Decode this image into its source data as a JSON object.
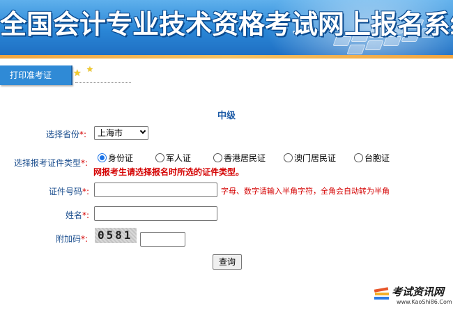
{
  "banner": {
    "title": "全国会计专业技术资格考试网上报名系统",
    "colors": {
      "top": "#5fb0ec",
      "bottom": "#1f6fc3",
      "stripe": "#f2a540"
    }
  },
  "nav": {
    "active_tab": "打印准考证",
    "star_icon": "star-icon"
  },
  "form": {
    "section_title": "中级",
    "province": {
      "label": "选择省份",
      "required_mark": "*:",
      "value": "上海市"
    },
    "id_type": {
      "label": "选择报考证件类型",
      "required_mark": "*:",
      "options": [
        "身份证",
        "军人证",
        "香港居民证",
        "澳门居民证",
        "台胞证"
      ],
      "selected": "身份证",
      "note": "网报考生请选择报名时所选的证件类型。"
    },
    "id_number": {
      "label": "证件号码",
      "required_mark": "*:",
      "value": "",
      "hint": "字母、数字请输入半角字符，全角会自动转为半角"
    },
    "name": {
      "label": "姓名",
      "required_mark": "*:",
      "value": ""
    },
    "captcha": {
      "label": "附加码",
      "required_mark": "*:",
      "image_text": "0581",
      "value": ""
    },
    "submit_label": "查询"
  },
  "watermark": {
    "title": "考试资讯网",
    "url": "www.KaoShi86.Com"
  },
  "colors": {
    "accent": "#2f8ad6",
    "label": "#1c4f8f",
    "required": "#d40000",
    "title": "#1c5aa6"
  }
}
